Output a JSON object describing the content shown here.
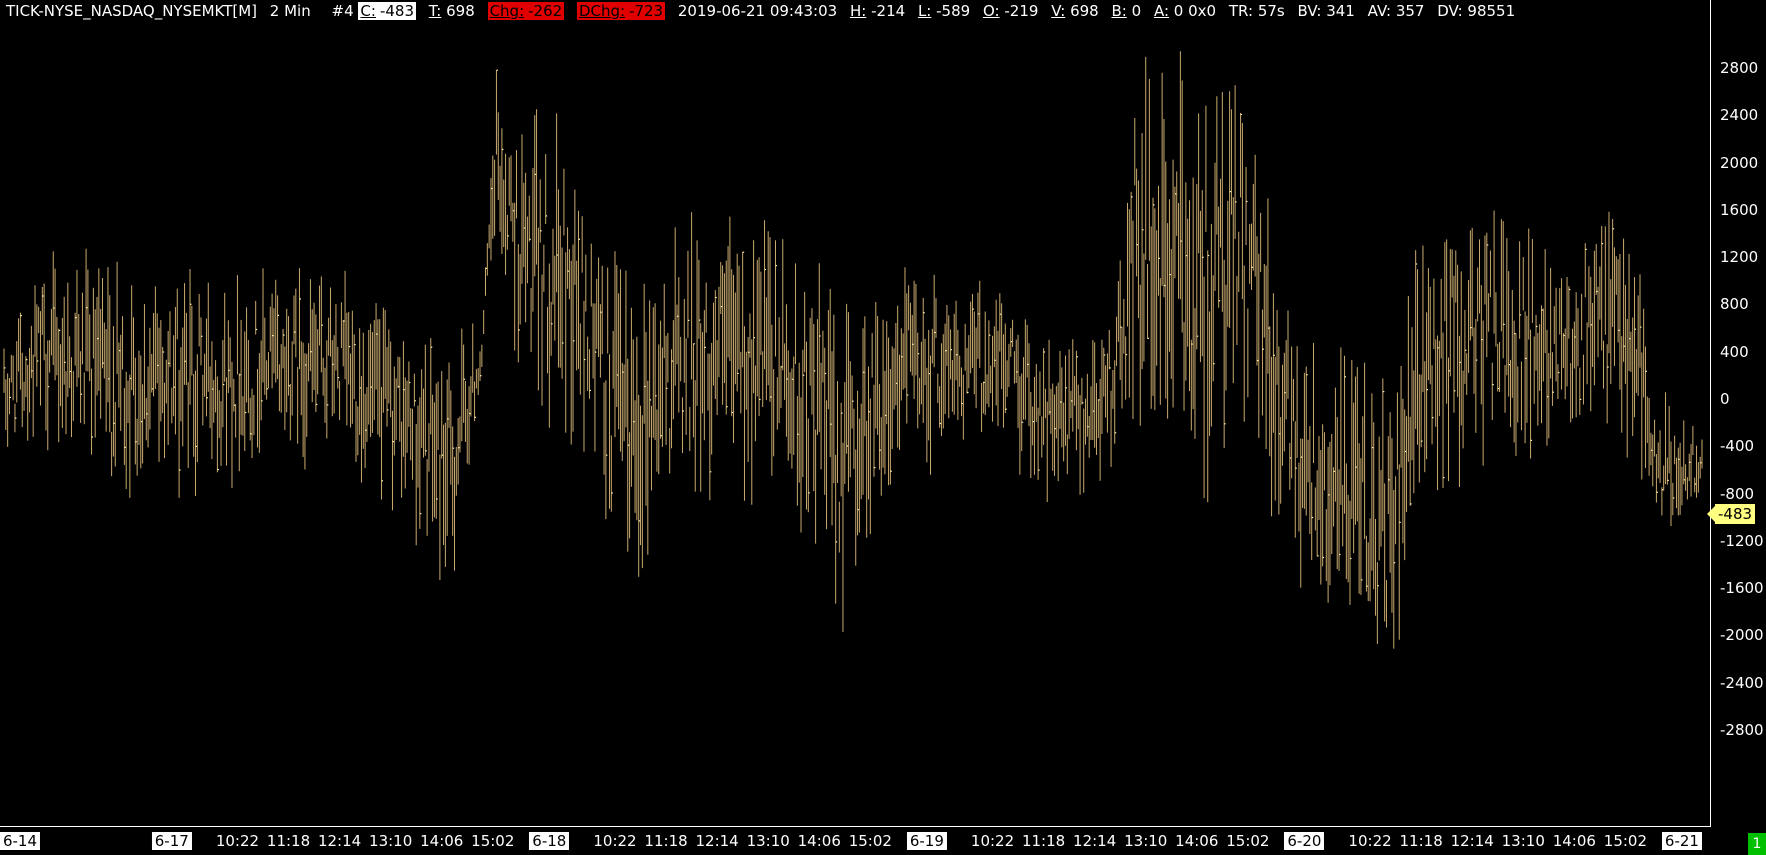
{
  "header": {
    "symbol": "TICK-NYSE_NASDAQ_NYSEMKT[M]",
    "interval": "2 Min",
    "chart_num": "#4",
    "c_label": "C:",
    "c_value": "-483",
    "t_label": "T:",
    "t_value": "698",
    "chg_label": "Chg:",
    "chg_value": "-262",
    "dchg_label": "DChg:",
    "dchg_value": "-723",
    "datetime": "2019-06-21 09:43:03",
    "h_label": "H:",
    "h_value": "-214",
    "l_label": "L:",
    "l_value": "-589",
    "o_label": "O:",
    "o_value": "-219",
    "v_label": "V:",
    "v_value": "698",
    "b_label": "B:",
    "b_value": "0",
    "a_label": "A:",
    "a_value": "0 0x0",
    "tr_label": "TR:",
    "tr_value": "57s",
    "bv_label": "BV:",
    "bv_value": "341",
    "av_label": "AV:",
    "av_value": "357",
    "dv_label": "DV:",
    "dv_value": "98551"
  },
  "last_price_label": "-483",
  "corner_badge": "1",
  "colors": {
    "background": "#000000",
    "bars": "#c8aa6e",
    "close_tick": "#fff3b0",
    "last_price_bg": "#ffff80",
    "chg_bg": "#e00000",
    "badge_bg": "#00c000"
  },
  "chart_data": {
    "type": "bar",
    "style": "ohlc-range-bars",
    "ylim": [
      -2800,
      3100
    ],
    "yticks": [
      2800,
      2400,
      2000,
      1600,
      1200,
      800,
      400,
      0,
      -400,
      -800,
      -1200,
      -1600,
      -2000,
      -2400,
      -2800
    ],
    "ytick_labels": [
      "2800",
      "2400",
      "2000",
      "1600",
      "1200",
      "800",
      "400",
      "0",
      "-400",
      "-800",
      "-1200",
      "-1600",
      "-2000",
      "-2400",
      "-2800"
    ],
    "x_labels": [
      {
        "text": "6-14",
        "day": true,
        "pos": 0
      },
      {
        "text": "6-17",
        "day": true,
        "pos": 92
      },
      {
        "text": "10:22",
        "day": false,
        "pos": 128
      },
      {
        "text": "11:18",
        "day": false,
        "pos": 156
      },
      {
        "text": "12:14",
        "day": false,
        "pos": 184
      },
      {
        "text": "13:10",
        "day": false,
        "pos": 212
      },
      {
        "text": "14:06",
        "day": false,
        "pos": 240
      },
      {
        "text": "15:02",
        "day": false,
        "pos": 268
      },
      {
        "text": "6-18",
        "day": true,
        "pos": 299
      },
      {
        "text": "10:22",
        "day": false,
        "pos": 335
      },
      {
        "text": "11:18",
        "day": false,
        "pos": 363
      },
      {
        "text": "12:14",
        "day": false,
        "pos": 391
      },
      {
        "text": "13:10",
        "day": false,
        "pos": 419
      },
      {
        "text": "14:06",
        "day": false,
        "pos": 447
      },
      {
        "text": "15:02",
        "day": false,
        "pos": 475
      },
      {
        "text": "6-19",
        "day": true,
        "pos": 506
      },
      {
        "text": "10:22",
        "day": false,
        "pos": 542
      },
      {
        "text": "11:18",
        "day": false,
        "pos": 570
      },
      {
        "text": "12:14",
        "day": false,
        "pos": 598
      },
      {
        "text": "13:10",
        "day": false,
        "pos": 626
      },
      {
        "text": "14:06",
        "day": false,
        "pos": 654
      },
      {
        "text": "15:02",
        "day": false,
        "pos": 682
      },
      {
        "text": "6-20",
        "day": true,
        "pos": 713
      },
      {
        "text": "10:22",
        "day": false,
        "pos": 749
      },
      {
        "text": "11:18",
        "day": false,
        "pos": 777
      },
      {
        "text": "12:14",
        "day": false,
        "pos": 805
      },
      {
        "text": "13:10",
        "day": false,
        "pos": 833
      },
      {
        "text": "14:06",
        "day": false,
        "pos": 861
      },
      {
        "text": "15:02",
        "day": false,
        "pos": 889
      },
      {
        "text": "6-21",
        "day": true,
        "pos": 920
      }
    ],
    "bar_count": 932,
    "anchors": [
      {
        "bar": 0,
        "center": 0,
        "range": 600
      },
      {
        "bar": 20,
        "center": 400,
        "range": 900
      },
      {
        "bar": 40,
        "center": 300,
        "range": 1100
      },
      {
        "bar": 60,
        "center": 100,
        "range": 1300
      },
      {
        "bar": 90,
        "center": 200,
        "range": 1200
      },
      {
        "bar": 120,
        "center": 200,
        "range": 1100
      },
      {
        "bar": 150,
        "center": 300,
        "range": 1000
      },
      {
        "bar": 180,
        "center": 300,
        "range": 1000
      },
      {
        "bar": 220,
        "center": -200,
        "range": 1000
      },
      {
        "bar": 245,
        "center": -600,
        "range": 1400
      },
      {
        "bar": 262,
        "center": 400,
        "range": 300
      },
      {
        "bar": 270,
        "center": 2000,
        "range": 1000
      },
      {
        "bar": 285,
        "center": 1200,
        "range": 1400
      },
      {
        "bar": 310,
        "center": 1000,
        "range": 1600
      },
      {
        "bar": 340,
        "center": -300,
        "range": 1700
      },
      {
        "bar": 370,
        "center": 300,
        "range": 1400
      },
      {
        "bar": 400,
        "center": 400,
        "range": 1500
      },
      {
        "bar": 430,
        "center": 200,
        "range": 1400
      },
      {
        "bar": 460,
        "center": -500,
        "range": 1600
      },
      {
        "bar": 490,
        "center": 300,
        "range": 1200
      },
      {
        "bar": 520,
        "center": 300,
        "range": 900
      },
      {
        "bar": 550,
        "center": 300,
        "range": 900
      },
      {
        "bar": 580,
        "center": -300,
        "range": 900
      },
      {
        "bar": 610,
        "center": 200,
        "range": 900
      },
      {
        "bar": 620,
        "center": 1200,
        "range": 2000
      },
      {
        "bar": 650,
        "center": 1000,
        "range": 2200
      },
      {
        "bar": 680,
        "center": 1200,
        "range": 2000
      },
      {
        "bar": 700,
        "center": -100,
        "range": 1400
      },
      {
        "bar": 730,
        "center": -800,
        "range": 1400
      },
      {
        "bar": 760,
        "center": -1200,
        "range": 1600
      },
      {
        "bar": 780,
        "center": 300,
        "range": 1500
      },
      {
        "bar": 810,
        "center": 600,
        "range": 1300
      },
      {
        "bar": 840,
        "center": 500,
        "range": 1100
      },
      {
        "bar": 870,
        "center": 600,
        "range": 1200
      },
      {
        "bar": 895,
        "center": 600,
        "range": 1200
      },
      {
        "bar": 905,
        "center": -700,
        "range": 900
      },
      {
        "bar": 931,
        "center": -483,
        "range": 400
      }
    ]
  }
}
